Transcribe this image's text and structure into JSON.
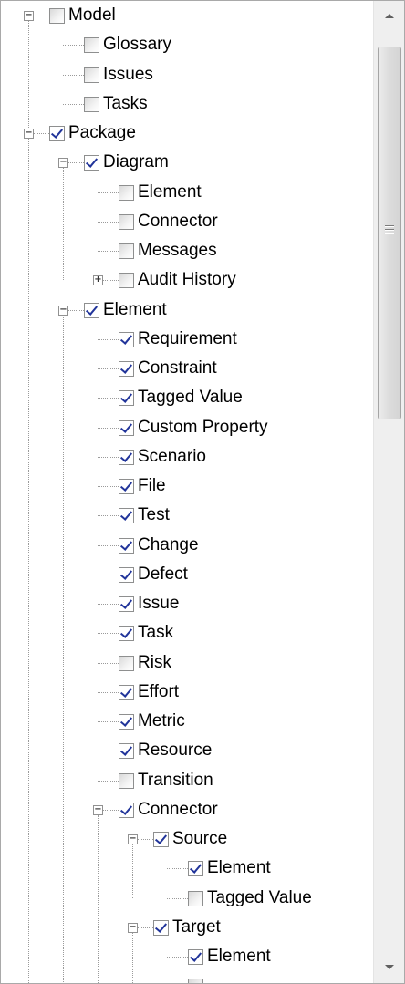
{
  "tree": {
    "rows": [
      {
        "label": "Model",
        "level": 0,
        "checked": false,
        "expander": "minus"
      },
      {
        "label": "Glossary",
        "level": 1,
        "checked": false,
        "expander": null
      },
      {
        "label": "Issues",
        "level": 1,
        "checked": false,
        "expander": null
      },
      {
        "label": "Tasks",
        "level": 1,
        "checked": false,
        "expander": null
      },
      {
        "label": "Package",
        "level": 0,
        "checked": true,
        "expander": "minus"
      },
      {
        "label": "Diagram",
        "level": 1,
        "checked": true,
        "expander": "minus"
      },
      {
        "label": "Element",
        "level": 2,
        "checked": false,
        "expander": null
      },
      {
        "label": "Connector",
        "level": 2,
        "checked": false,
        "expander": null
      },
      {
        "label": "Messages",
        "level": 2,
        "checked": false,
        "expander": null
      },
      {
        "label": "Audit History",
        "level": 2,
        "checked": false,
        "expander": "plus"
      },
      {
        "label": "Element",
        "level": 1,
        "checked": true,
        "expander": "minus"
      },
      {
        "label": "Requirement",
        "level": 2,
        "checked": true,
        "expander": null
      },
      {
        "label": "Constraint",
        "level": 2,
        "checked": true,
        "expander": null
      },
      {
        "label": "Tagged Value",
        "level": 2,
        "checked": true,
        "expander": null
      },
      {
        "label": "Custom Property",
        "level": 2,
        "checked": true,
        "expander": null
      },
      {
        "label": "Scenario",
        "level": 2,
        "checked": true,
        "expander": null
      },
      {
        "label": "File",
        "level": 2,
        "checked": true,
        "expander": null
      },
      {
        "label": "Test",
        "level": 2,
        "checked": true,
        "expander": null
      },
      {
        "label": "Change",
        "level": 2,
        "checked": true,
        "expander": null
      },
      {
        "label": "Defect",
        "level": 2,
        "checked": true,
        "expander": null
      },
      {
        "label": "Issue",
        "level": 2,
        "checked": true,
        "expander": null
      },
      {
        "label": "Task",
        "level": 2,
        "checked": true,
        "expander": null
      },
      {
        "label": "Risk",
        "level": 2,
        "checked": false,
        "expander": null
      },
      {
        "label": "Effort",
        "level": 2,
        "checked": true,
        "expander": null
      },
      {
        "label": "Metric",
        "level": 2,
        "checked": true,
        "expander": null
      },
      {
        "label": "Resource",
        "level": 2,
        "checked": true,
        "expander": null
      },
      {
        "label": "Transition",
        "level": 2,
        "checked": false,
        "expander": null
      },
      {
        "label": "Connector",
        "level": 2,
        "checked": true,
        "expander": "minus"
      },
      {
        "label": "Source",
        "level": 3,
        "checked": true,
        "expander": "minus"
      },
      {
        "label": "Element",
        "level": 4,
        "checked": true,
        "expander": null
      },
      {
        "label": "Tagged Value",
        "level": 4,
        "checked": false,
        "expander": null
      },
      {
        "label": "Target",
        "level": 3,
        "checked": true,
        "expander": "minus"
      },
      {
        "label": "Element",
        "level": 4,
        "checked": true,
        "expander": null
      },
      {
        "label": "",
        "level": 4,
        "checked": false,
        "expander": null
      }
    ]
  },
  "scrollbar": {
    "up_icon": "arrow-up-icon",
    "down_icon": "arrow-down-icon",
    "grip_icon": "grip-icon"
  }
}
